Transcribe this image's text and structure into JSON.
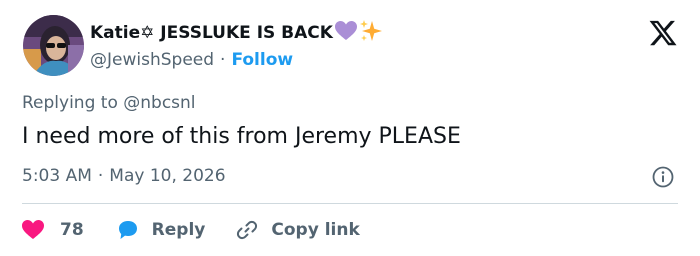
{
  "author": {
    "display_name": "Katie✡ JESSLUKE IS BACK",
    "handle": "@JewishSpeed",
    "separator": "·",
    "follow_label": "Follow",
    "badges": [
      "purple-heart-emoji",
      "sparkles-emoji"
    ]
  },
  "tweet": {
    "replying_prefix": "Replying to",
    "replying_to": "@nbcsnl",
    "text": "I need more of this from Jeremy PLEASE",
    "time": "5:03 AM",
    "separator": "·",
    "date": "May 10, 2026"
  },
  "actions": {
    "like_count": "78",
    "reply_label": "Reply",
    "copy_label": "Copy link"
  },
  "icons": {
    "brand": "x-logo-icon",
    "info": "info-icon",
    "like": "heart-icon",
    "reply": "speech-bubble-icon",
    "copy": "link-icon"
  },
  "colors": {
    "follow": "#1d9bf0",
    "like": "#f91880",
    "reply": "#1d9bf0",
    "secondary_text": "#536471",
    "primary_text": "#0f1419"
  }
}
